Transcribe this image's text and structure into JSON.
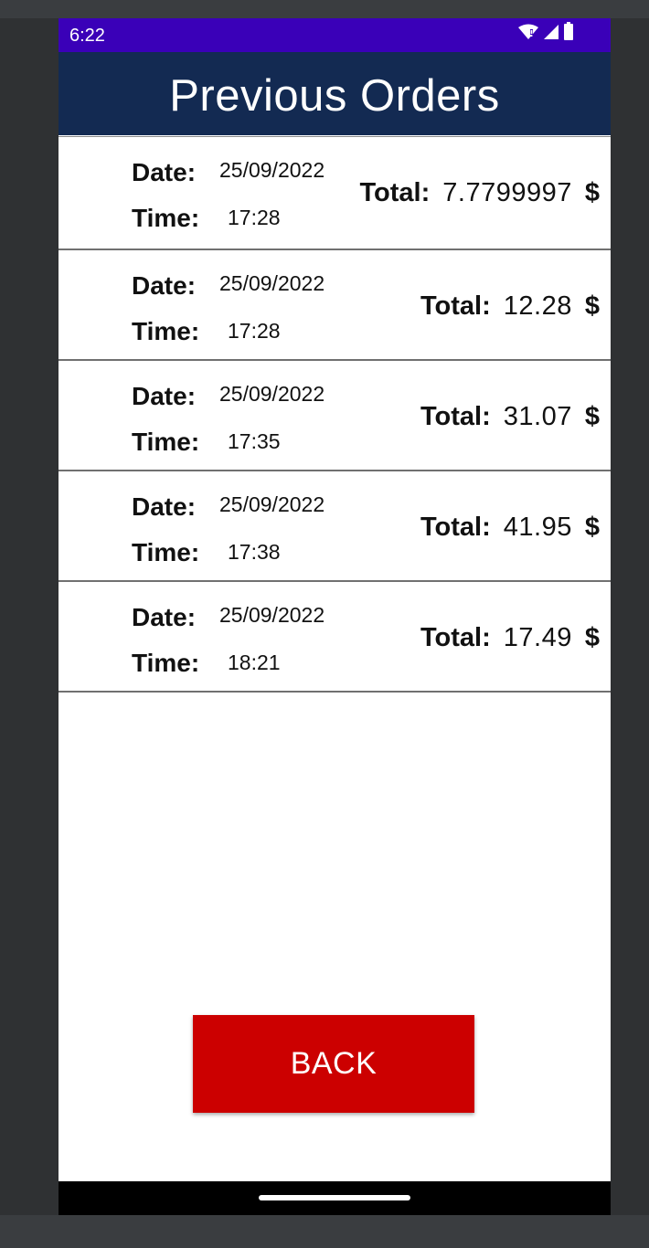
{
  "status_bar": {
    "time": "6:22",
    "icons": [
      "wifi-alert-icon",
      "signal-icon",
      "battery-icon"
    ]
  },
  "app_bar": {
    "title": "Previous Orders"
  },
  "labels": {
    "date": "Date:",
    "time": "Time:",
    "total": "Total:",
    "currency": "$"
  },
  "orders": [
    {
      "date": "25/09/2022",
      "time": "17:28",
      "total": "7.7799997"
    },
    {
      "date": "25/09/2022",
      "time": "17:28",
      "total": "12.28"
    },
    {
      "date": "25/09/2022",
      "time": "17:35",
      "total": "31.07"
    },
    {
      "date": "25/09/2022",
      "time": "17:38",
      "total": "41.95"
    },
    {
      "date": "25/09/2022",
      "time": "18:21",
      "total": "17.49"
    }
  ],
  "back_button": {
    "label": "BACK"
  },
  "colors": {
    "status_bar": "#3a00b8",
    "app_bar": "#132a52",
    "back_button": "#cc0000"
  }
}
